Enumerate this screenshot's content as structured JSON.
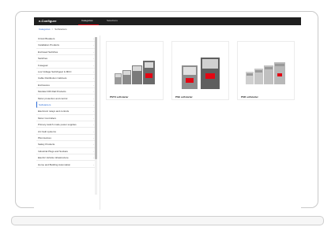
{
  "header": {
    "brand": "e-Configure",
    "tabs": [
      {
        "label": "Categories",
        "active": true
      },
      {
        "label": "Selections",
        "active": false
      }
    ],
    "accent_color": "#e30613"
  },
  "breadcrumb": {
    "parent": "Categories",
    "separator": ">",
    "current": "Softstarters"
  },
  "sidebar": {
    "items": [
      {
        "label": "Circuit Breakers"
      },
      {
        "label": "Installation Products"
      },
      {
        "label": "Enclosed Switches"
      },
      {
        "label": "Switches"
      },
      {
        "label": "Fusegear"
      },
      {
        "label": "Low Voltage Switchgear & MCC"
      },
      {
        "label": "Cable Distribution Cabinets"
      },
      {
        "label": "Enclosures"
      },
      {
        "label": "Modular DIN Rail Products"
      },
      {
        "label": "Motor protection and control"
      },
      {
        "label": "Softstarters",
        "active": true
      },
      {
        "label": "Electronic relays and controls"
      },
      {
        "label": "Motor Controllers"
      },
      {
        "label": "Primary switch mode power supplies"
      },
      {
        "label": "Arc fault systems"
      },
      {
        "label": "Pilot devices"
      },
      {
        "label": "Safety Products"
      },
      {
        "label": "Industrial Plugs and Sockets"
      },
      {
        "label": "Electric Vehicle infrastructure"
      },
      {
        "label": "Home and Building Automation"
      }
    ],
    "chevron_icon": "chevron-right-icon"
  },
  "products": [
    {
      "label": "PSTX softstarter"
    },
    {
      "label": "PSE softstarter"
    },
    {
      "label": "PSR softstarter"
    }
  ]
}
